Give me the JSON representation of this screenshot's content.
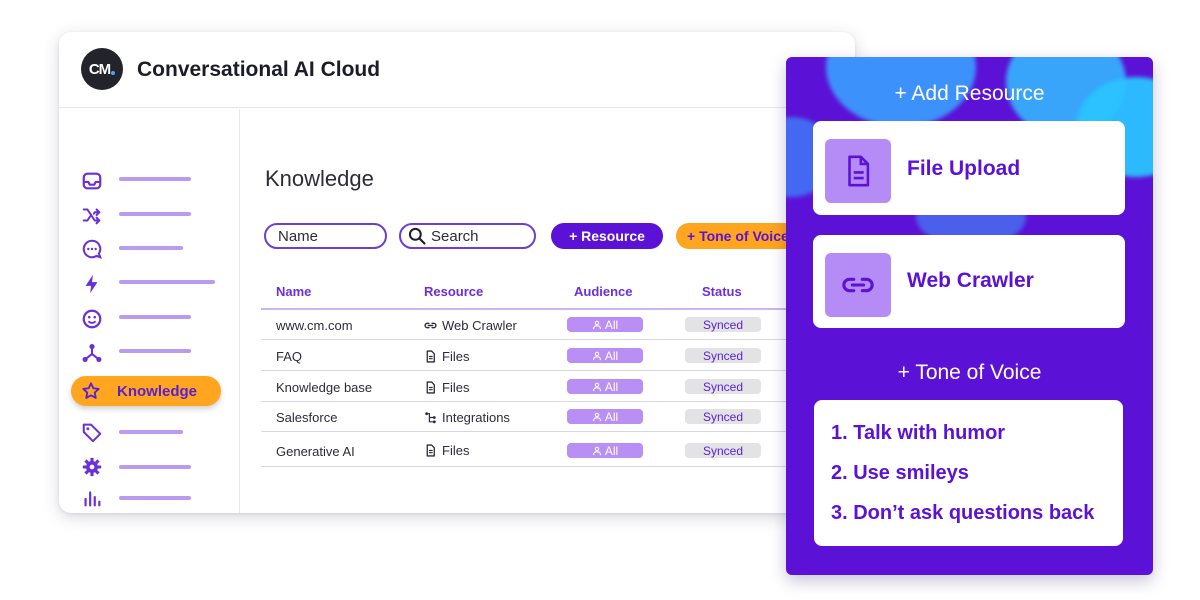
{
  "app": {
    "logo_text": "CM",
    "title": "Conversational AI Cloud"
  },
  "sidebar": {
    "active_label": "Knowledge",
    "icons": [
      "inbox-icon",
      "shuffle-icon",
      "chat-icon",
      "lightning-icon",
      "smiley-icon",
      "network-icon",
      "star-icon",
      "tag-icon",
      "gear-icon",
      "bar-chart-icon"
    ]
  },
  "page": {
    "title": "Knowledge"
  },
  "toolbar": {
    "name_field": "Name",
    "search_field": "Search",
    "resource_button": "+ Resource",
    "tone_button": "+ Tone of Voice"
  },
  "table": {
    "headers": [
      "Name",
      "Resource",
      "Audience",
      "Status"
    ],
    "rows": [
      {
        "name": "www.cm.com",
        "resource": "Web Crawler",
        "resource_icon": "link-icon",
        "audience": "All",
        "status": "Synced"
      },
      {
        "name": "FAQ",
        "resource": "Files",
        "resource_icon": "file-icon",
        "audience": "All",
        "status": "Synced"
      },
      {
        "name": "Knowledge base",
        "resource": "Files",
        "resource_icon": "file-icon",
        "audience": "All",
        "status": "Synced"
      },
      {
        "name": "Salesforce",
        "resource": "Integrations",
        "resource_icon": "integration-icon",
        "audience": "All",
        "status": "Synced"
      },
      {
        "name": "Generative AI",
        "resource": "Files",
        "resource_icon": "file-icon",
        "audience": "All",
        "status": "Synced"
      }
    ]
  },
  "panel": {
    "add_resource_title": "+ Add Resource",
    "file_upload": "File Upload",
    "web_crawler": "Web Crawler",
    "tone_title": "+ Tone of Voice",
    "tone_items": [
      "1. Talk with humor",
      "2. Use smileys",
      "3. Don’t ask questions back"
    ]
  },
  "colors": {
    "brand_purple": "#5b12d6",
    "accent_orange": "#ffa51f",
    "light_purple": "#b98ef5"
  }
}
